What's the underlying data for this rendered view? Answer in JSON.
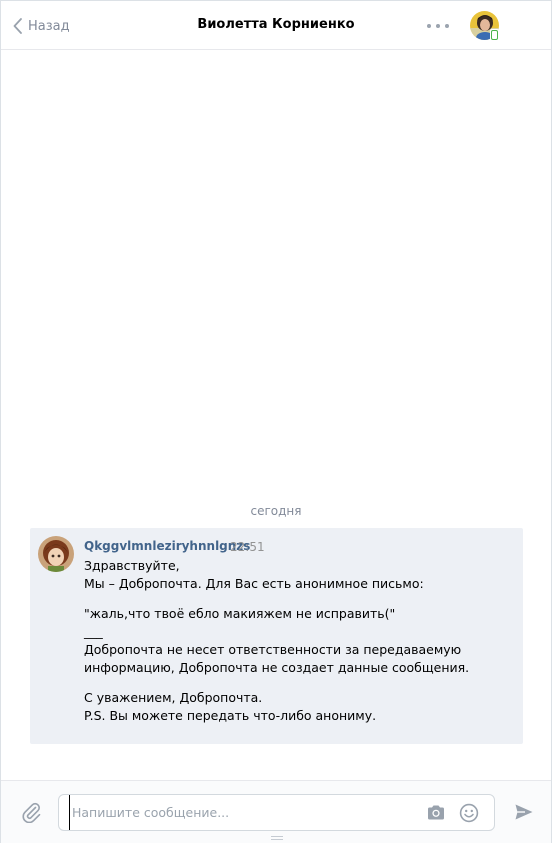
{
  "header": {
    "back_label": "Назад",
    "title": "Виолетта Корниенко",
    "more_icon": "ellipsis-icon",
    "online_badge": "mobile-online-icon"
  },
  "date_separator": "сегодня",
  "message": {
    "author": "Qkggvlmnleziryhnnlgnzs",
    "time": "22:51",
    "lines": [
      "Здравствуйте,",
      "Мы – Добропочта. Для Вас есть анонимное письмо:",
      "\"жаль,что твоё ебло макияжем не исправить(\"",
      "___",
      "Добропочта не несет ответственности за передаваемую",
      "информацию, Добропочта не создает данные сообщения.",
      "С уважением, Добропочта.",
      "P.S. Вы можете передать что-либо анониму."
    ]
  },
  "composer": {
    "placeholder": "Напишите сообщение...",
    "value": "",
    "attach_icon": "paperclip-icon",
    "camera_icon": "camera-icon",
    "emoji_icon": "smile-icon",
    "send_icon": "send-icon"
  },
  "colors": {
    "link": "#42648b",
    "message_bg": "#edf0f5",
    "online": "#4bb34b",
    "muted": "#828a99"
  }
}
